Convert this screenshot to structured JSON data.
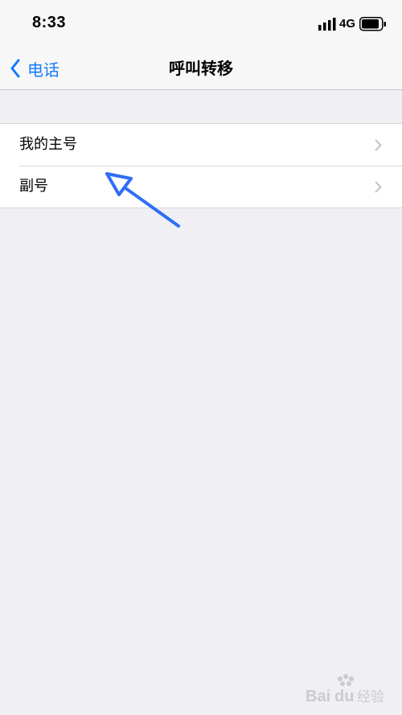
{
  "status_bar": {
    "time": "8:33",
    "network": "4G",
    "signal_icon": "signal-bars-icon",
    "battery_icon": "battery-icon"
  },
  "nav": {
    "back_label": "电话",
    "back_icon": "chevron-left-icon",
    "title": "呼叫转移"
  },
  "list": {
    "items": [
      {
        "label": "我的主号",
        "icon": "chevron-right-icon"
      },
      {
        "label": "副号",
        "icon": "chevron-right-icon"
      }
    ]
  },
  "colors": {
    "accent": "#1479f9",
    "background": "#efeff4",
    "annotation": "#2f6ef5"
  },
  "watermark_text": "Baidu经验"
}
